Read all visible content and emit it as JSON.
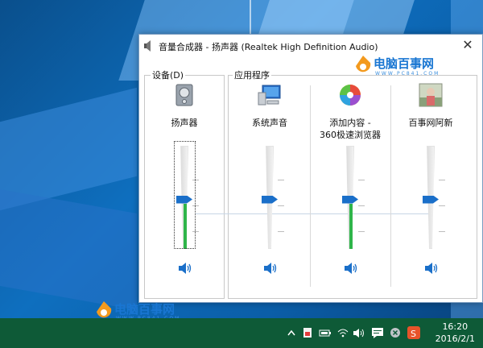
{
  "window": {
    "title": "音量合成器 - 扬声器 (Realtek High Definition Audio)",
    "close_glyph": "✕"
  },
  "groups": {
    "device_label": "设备(D)",
    "apps_label": "应用程序"
  },
  "channels": [
    {
      "label": "扬声器",
      "icon": "speaker-device-icon",
      "volume": 0.48,
      "peak": 0.44
    },
    {
      "label": "系统声音",
      "icon": "system-sounds-icon",
      "volume": 0.48,
      "peak": 0
    },
    {
      "label": "添加内容 -\n360极速浏览器",
      "icon": "browser-360-icon",
      "volume": 0.48,
      "peak": 0.44
    },
    {
      "label": "百事网阿新",
      "icon": "app-thumbnail-icon",
      "volume": 0.48,
      "peak": 0
    }
  ],
  "watermark": {
    "title": "电脑百事网",
    "url": "WWW.PC841.COM"
  },
  "taskbar": {
    "time": "16:20",
    "date": "2016/2/1",
    "tray_icons": [
      "chevron-up-icon",
      "app-tray-icon",
      "battery-icon",
      "wifi-icon",
      "volume-icon",
      "notification-icon",
      "close-circle-icon",
      "sogou-icon"
    ]
  },
  "colors": {
    "accent": "#1a6fc9",
    "level": "#2fb54a",
    "taskbar": "#0e5a37"
  }
}
